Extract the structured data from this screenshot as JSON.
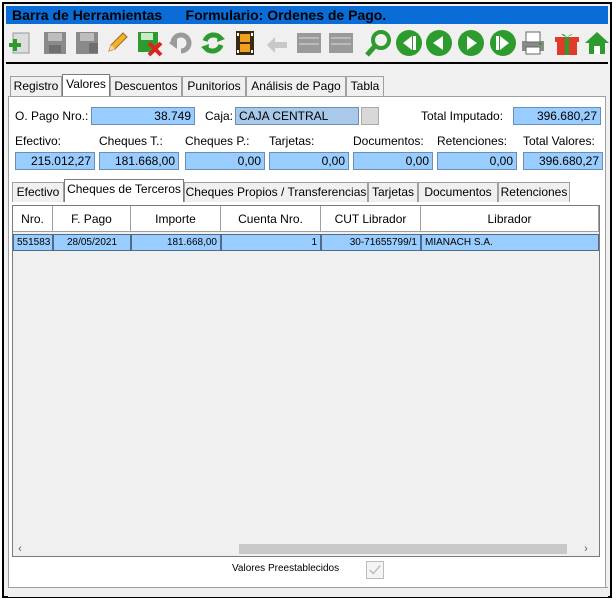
{
  "titlebar": {
    "text": "Barra de Herramientas      Formulario: Ordenes de Pago."
  },
  "toolbar": {
    "icons": [
      "add-icon",
      "save-icon",
      "save-as-icon",
      "edit-icon",
      "delete-icon",
      "undo-icon",
      "refresh-icon",
      "film-icon",
      "back-arrow-icon",
      "blank-icon",
      "blank-icon",
      "search-icon",
      "first-icon",
      "prev-icon",
      "next-icon",
      "last-icon",
      "print-icon",
      "gift-icon",
      "home-icon"
    ]
  },
  "outer_tabs": [
    "Registro",
    "Valores",
    "Descuentos",
    "Punitorios",
    "Análisis de Pago",
    "Tabla"
  ],
  "form": {
    "opago_label": "O. Pago Nro.:",
    "opago_value": "38.749",
    "caja_label": "Caja:",
    "caja_value": "CAJA CENTRAL",
    "total_imputado_label": "Total Imputado:",
    "total_imputado_value": "396.680,27",
    "efectivo_label": "Efectivo:",
    "efectivo_value": "215.012,27",
    "cheques_t_label": "Cheques T.:",
    "cheques_t_value": "181.668,00",
    "cheques_p_label": "Cheques P.:",
    "cheques_p_value": "0,00",
    "tarjetas_label": "Tarjetas:",
    "tarjetas_value": "0,00",
    "documentos_label": "Documentos:",
    "documentos_value": "0,00",
    "retenciones_label": "Retenciones:",
    "retenciones_value": "0,00",
    "total_valores_label": "Total Valores:",
    "total_valores_value": "396.680,27"
  },
  "inner_tabs": [
    "Efectivo",
    "Cheques de Terceros",
    "Cheques Propios / Transferencias",
    "Tarjetas",
    "Documentos",
    "Retenciones"
  ],
  "table": {
    "headers": [
      "Nro.",
      "F. Pago",
      "Importe",
      "Cuenta Nro.",
      "CUT Librador",
      "Librador"
    ],
    "rows": [
      [
        "551583",
        "28/05/2021",
        "181.668,00",
        "1",
        "30-71655799/1",
        "MIANACH S.A."
      ]
    ]
  },
  "footer": {
    "valores_preestablecidos_label": "Valores Preestablecidos"
  },
  "colors": {
    "title_bg": "#0a6cd6",
    "field_bg": "#99ccff",
    "icon_green": "#2e9b2e"
  }
}
